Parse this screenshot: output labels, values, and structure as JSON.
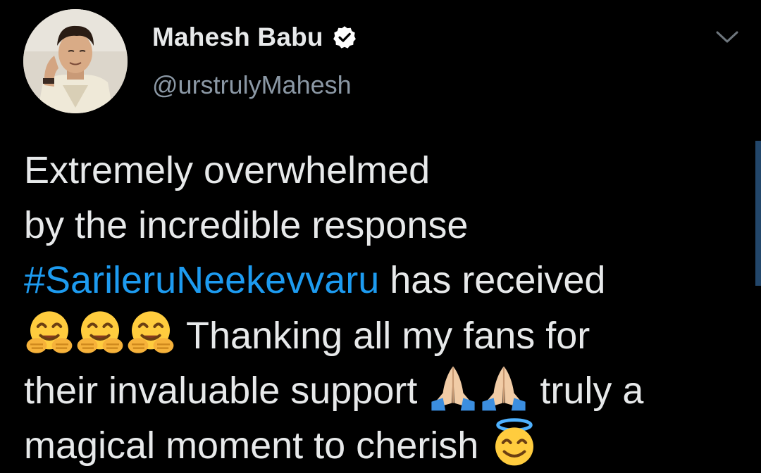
{
  "tweet": {
    "author": {
      "display_name": "Mahesh Babu",
      "handle": "@urstrulyMahesh",
      "verified": true
    },
    "body": {
      "line1": "Extremely overwhelmed",
      "line2": "by the incredible response",
      "hashtag": "#SarileruNeekevvaru",
      "line3_rest": " has received",
      "line4_rest": " Thanking all my fans for",
      "line5_text": "their invaluable support ",
      "line5_rest": " truly a",
      "line6_text": "magical moment to cherish "
    },
    "emojis": [
      "hugging-face-emoji",
      "folded-hands-emoji",
      "smiling-face-with-halo-emoji"
    ]
  },
  "colors": {
    "background": "#000000",
    "text": "#e7e9ea",
    "secondary_text": "#8b98a5",
    "link": "#1d9bf0",
    "verified_badge": "#ffffff"
  },
  "icons": {
    "menu": "chevron-down-icon",
    "verified": "verified-badge-icon"
  }
}
